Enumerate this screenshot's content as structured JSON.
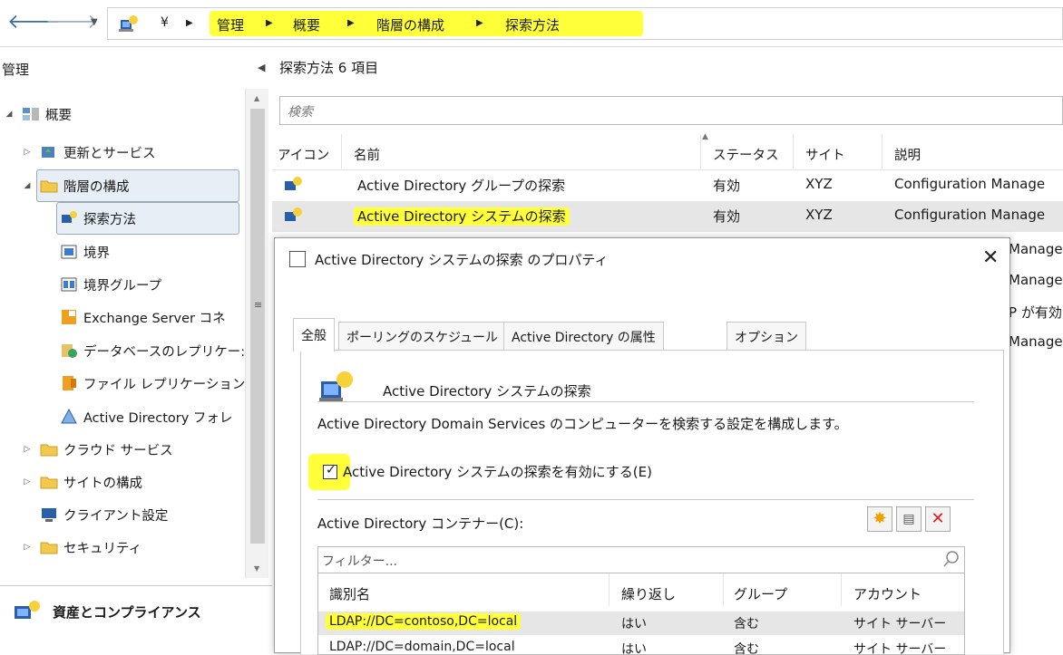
{
  "breadcrumb": {
    "root": "¥",
    "items": [
      "管理",
      "概要",
      "階層の構成",
      "探索方法"
    ]
  },
  "left_pane": {
    "title": "管理",
    "tree": [
      {
        "label": "概要"
      },
      {
        "label": "更新とサービス"
      },
      {
        "label": "階層の構成"
      },
      {
        "label": "探索方法"
      },
      {
        "label": "境界"
      },
      {
        "label": "境界グループ"
      },
      {
        "label": "Exchange Server コネ"
      },
      {
        "label": "データベースのレプリケー:"
      },
      {
        "label": "ファイル レプリケーション"
      },
      {
        "label": "Active Directory フォレ"
      },
      {
        "label": "クラウド サービス"
      },
      {
        "label": "サイトの構成"
      },
      {
        "label": "クライアント設定"
      },
      {
        "label": "セキュリティ"
      }
    ],
    "workspace": "資産とコンプライアンス"
  },
  "list": {
    "heading": "探索方法 6 項目",
    "search_placeholder": "検索",
    "columns": [
      "アイコン",
      "名前",
      "ステータス",
      "サイト",
      "説明"
    ],
    "rows": [
      {
        "name": "Active Directory グループの探索",
        "status": "有効",
        "site": "XYZ",
        "desc": "Configuration Manage"
      },
      {
        "name": "Active Directory システムの探索",
        "status": "有効",
        "site": "XYZ",
        "desc": "Configuration Manage"
      }
    ],
    "partial_desc": [
      "Manage",
      "Manage",
      "P が有効",
      "Manage"
    ]
  },
  "dialog": {
    "title": "Active Directory システムの探索 のプロパティ",
    "tabs": [
      "全般",
      "ポーリングのスケジュール",
      "Active Directory の属性",
      "オプション"
    ],
    "section_title": "Active Directory システムの探索",
    "description": "Active Directory Domain Services のコンピューターを検索する設定を構成します。",
    "checkbox_label": "Active Directory システムの探索を有効にする(E)",
    "checkbox_checked": true,
    "containers_label": "Active Directory コンテナー(C):",
    "filter_placeholder": "フィルター...",
    "grid_columns": [
      "識別名",
      "繰り返し",
      "グループ",
      "アカウント"
    ],
    "grid_rows": [
      {
        "dn": "LDAP://DC=contoso,DC=local",
        "recursive": "はい",
        "group": "含む",
        "account": "サイト サーバー"
      },
      {
        "dn": "LDAP://DC=domain,DC=local",
        "recursive": "はい",
        "group": "含む",
        "account": "サイト サーバー"
      }
    ]
  },
  "colors": {
    "highlight": "#ffff3a",
    "accent": "#3a6ea5"
  }
}
